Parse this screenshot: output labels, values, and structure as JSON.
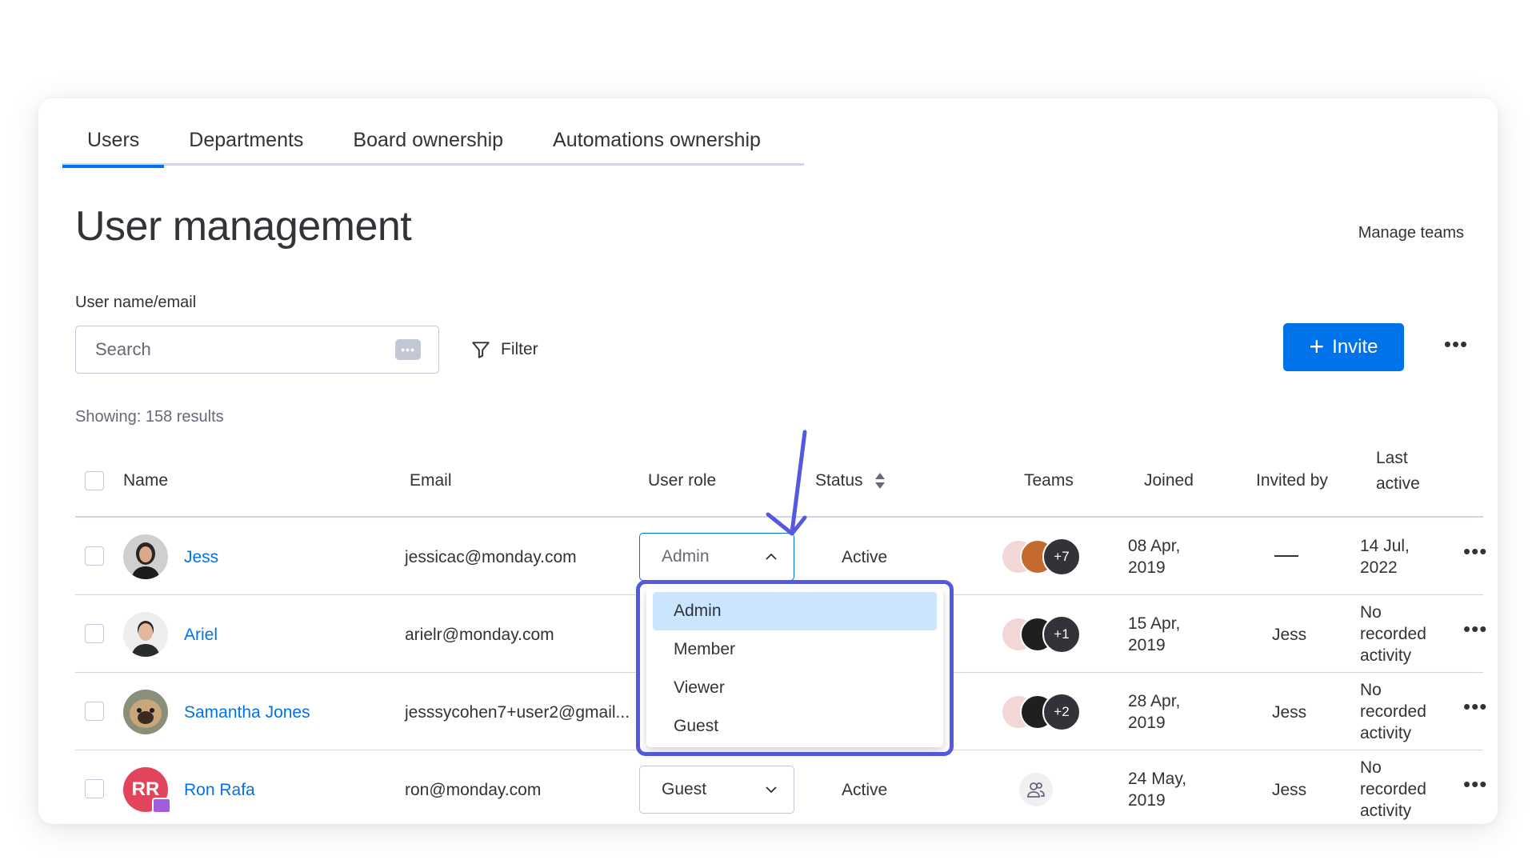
{
  "tabs": [
    "Users",
    "Departments",
    "Board ownership",
    "Automations ownership"
  ],
  "active_tab": 0,
  "page_title": "User management",
  "manage_teams": "Manage teams",
  "search": {
    "label": "User name/email",
    "placeholder": "Search",
    "kbd": "•••"
  },
  "filter_label": "Filter",
  "invite_label": "Invite",
  "invite_plus": "+",
  "more_icon": "•••",
  "showing": "Showing: 158 results",
  "columns": {
    "name": "Name",
    "email": "Email",
    "role": "User role",
    "status": "Status",
    "teams": "Teams",
    "joined": "Joined",
    "invited_by": "Invited by",
    "last_active_1": "Last",
    "last_active_2": "active"
  },
  "rows": [
    {
      "name": "Jess",
      "email": "jessicac@monday.com",
      "role": "Admin",
      "status": "Active",
      "teams_count": "+7",
      "joined_1": "08 Apr,",
      "joined_2": "2019",
      "invited_by": "",
      "last_1": "14 Jul,",
      "last_2": "2022",
      "last_3": ""
    },
    {
      "name": "Ariel",
      "email": "arielr@monday.com",
      "role": "",
      "status": "",
      "teams_count": "+1",
      "joined_1": "15 Apr,",
      "joined_2": "2019",
      "invited_by": "Jess",
      "last_1": "No",
      "last_2": "recorded",
      "last_3": "activity"
    },
    {
      "name": "Samantha Jones",
      "email": "jesssycohen7+user2@gmail...",
      "role": "",
      "status": "",
      "teams_count": "+2",
      "joined_1": "28 Apr,",
      "joined_2": "2019",
      "invited_by": "Jess",
      "last_1": "No",
      "last_2": "recorded",
      "last_3": "activity"
    },
    {
      "name": "Ron Rafa",
      "initials": "RR",
      "email": "ron@monday.com",
      "role": "Guest",
      "status": "Active",
      "teams_count": "",
      "joined_1": "24 May,",
      "joined_2": "2019",
      "invited_by": "Jess",
      "last_1": "No",
      "last_2": "recorded",
      "last_3": "activity"
    }
  ],
  "dropdown_options": [
    "Admin",
    "Member",
    "Viewer",
    "Guest"
  ],
  "dropdown_selected": "Admin",
  "colors": {
    "accent": "#0073ea",
    "highlight": "#5559df",
    "selected_bg": "#cce5ff",
    "guest_avatar": "#e2445c"
  }
}
